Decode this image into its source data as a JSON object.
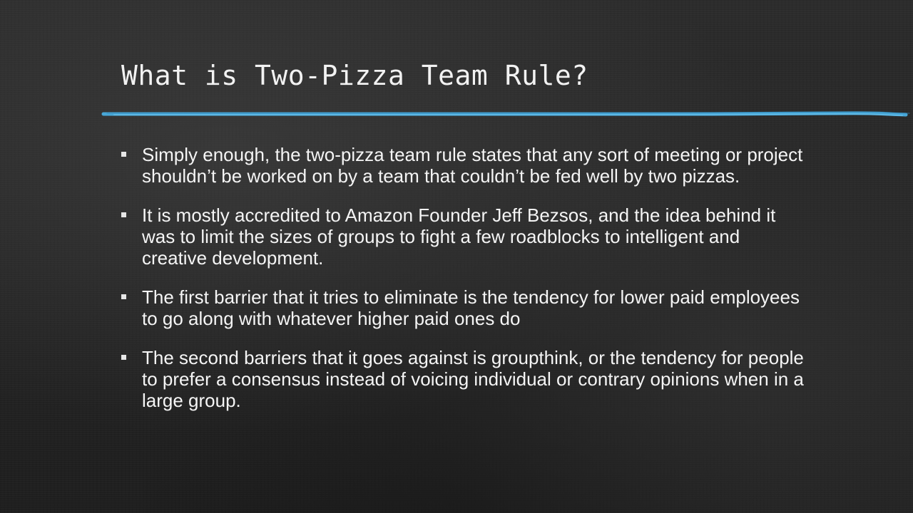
{
  "slide": {
    "title": "What is Two-Pizza Team Rule?",
    "accent_color": "#4aaee0",
    "bullets": [
      "Simply enough, the two-pizza team rule states that any sort of meeting or project shouldn’t be worked on by a team that couldn’t be fed well by two pizzas.",
      "It is mostly accredited to Amazon Founder Jeff Bezsos, and the idea behind it was to limit the sizes of groups to fight a few roadblocks to intelligent and creative development.",
      "The first barrier that it tries to eliminate is the tendency for lower paid employees to go along with whatever higher paid ones do",
      "The second barriers that it goes against is groupthink, or the tendency for people to prefer a consensus instead of voicing individual or contrary opinions when in a large group."
    ]
  }
}
